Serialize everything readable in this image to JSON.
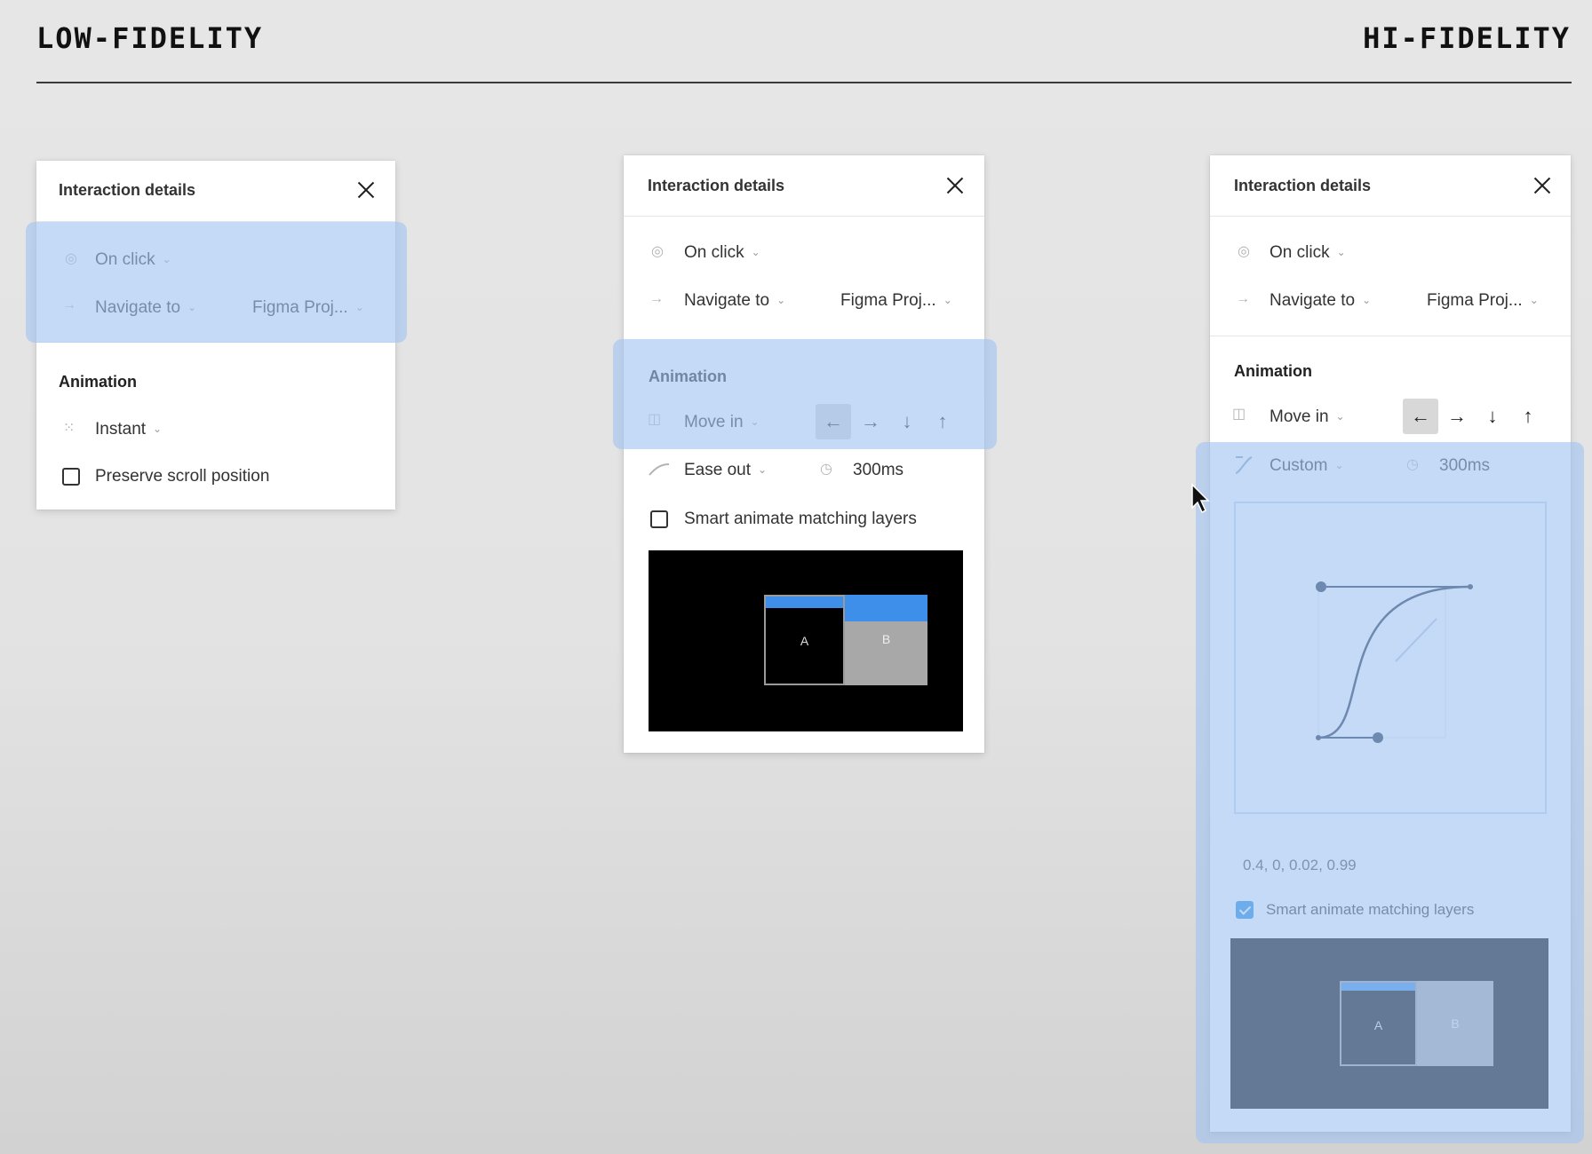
{
  "headings": {
    "left": "LOW-FIDELITY",
    "right": "HI-FIDELITY"
  },
  "panel_low": {
    "title": "Interaction details",
    "trigger": "On click",
    "action": "Navigate to",
    "destination": "Figma Proj...",
    "animation_heading": "Animation",
    "animation_type": "Instant",
    "preserve_scroll_label": "Preserve scroll position",
    "preserve_scroll_checked": false
  },
  "panel_mid": {
    "title": "Interaction details",
    "trigger": "On click",
    "action": "Navigate to",
    "destination": "Figma Proj...",
    "animation_heading": "Animation",
    "animation_type": "Move in",
    "directions": [
      "←",
      "→",
      "↓",
      "↑"
    ],
    "active_direction": "←",
    "easing": "Ease out",
    "duration": "300ms",
    "smart_animate_label": "Smart animate matching layers",
    "smart_animate_checked": false,
    "preview": {
      "frame_a": "A",
      "frame_b": "B"
    }
  },
  "panel_hi": {
    "title": "Interaction details",
    "trigger": "On click",
    "action": "Navigate to",
    "destination": "Figma Proj...",
    "animation_heading": "Animation",
    "animation_type": "Move in",
    "directions": [
      "←",
      "→",
      "↓",
      "↑"
    ],
    "active_direction": "←",
    "easing": "Custom",
    "duration": "300ms",
    "bezier_values": "0.4, 0, 0.02, 0.99",
    "smart_animate_label": "Smart animate matching layers",
    "smart_animate_checked": true,
    "preview": {
      "frame_a": "A",
      "frame_b": "B"
    }
  },
  "colors": {
    "highlight": "#a0c4f0",
    "accent_blue": "#3d8fea",
    "checkbox_blue": "#1e88e5"
  },
  "icons": [
    "trigger-dot-icon",
    "arrow-right-icon",
    "instant-icon",
    "move-in-icon",
    "ease-curve-icon",
    "clock-icon",
    "close-icon",
    "chevron-down-icon",
    "cursor-icon"
  ]
}
